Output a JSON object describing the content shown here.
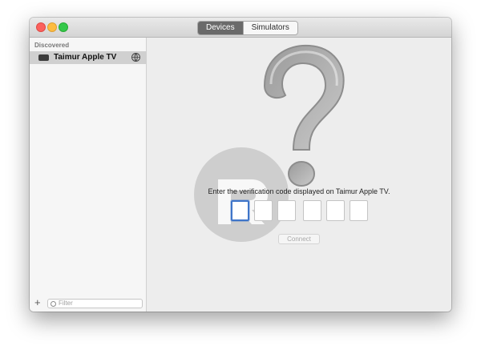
{
  "toolbar": {
    "tabs": [
      {
        "label": "Devices",
        "active": true
      },
      {
        "label": "Simulators",
        "active": false
      }
    ]
  },
  "sidebar": {
    "section_header": "Discovered",
    "devices": [
      {
        "label": "Taimur Apple TV",
        "icon": "apple-tv-icon",
        "status_icon": "globe-icon"
      }
    ],
    "footer": {
      "add_label": "+",
      "filter_placeholder": "Filter"
    }
  },
  "main": {
    "prompt": "Enter the verification code displayed on Taimur Apple TV.",
    "code_boxes": [
      "",
      "",
      "",
      "",
      "",
      ""
    ],
    "connect_label": "Connect"
  },
  "colors": {
    "focus_ring": "#3f75c9",
    "selected_row": "#d0d0d0",
    "segment_active": "#6a6a6a"
  }
}
